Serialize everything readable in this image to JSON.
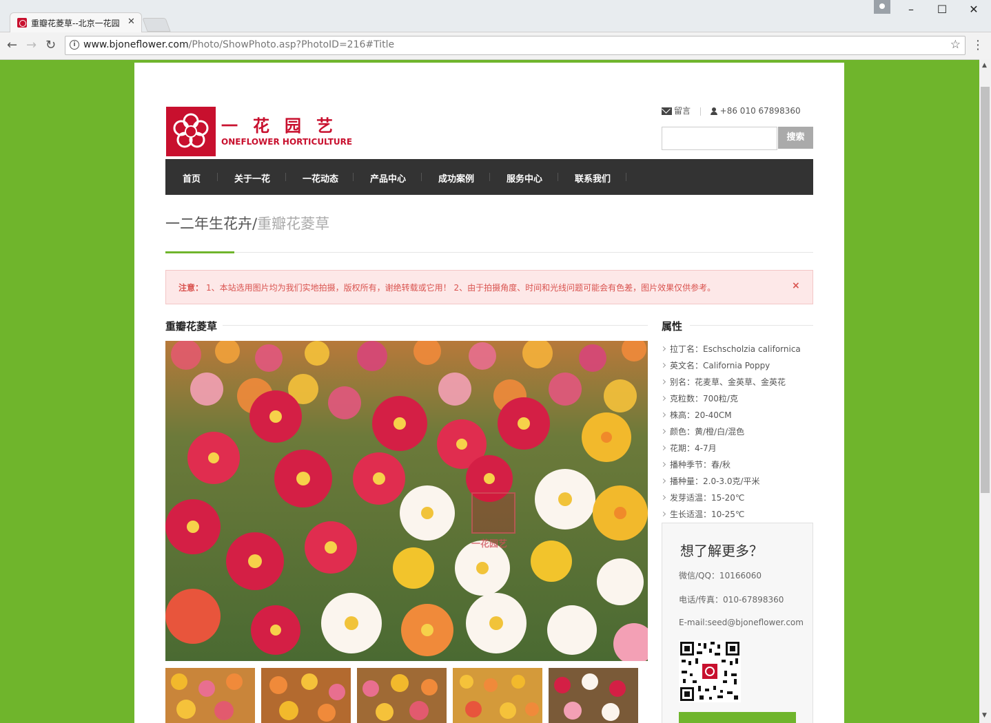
{
  "browser": {
    "tab_title": "重瓣花菱草--北京一花园",
    "url_host": "www.bjoneflower.com",
    "url_path": "/Photo/ShowPhoto.asp?PhotoID=216#Title"
  },
  "header": {
    "logo_cn": "一花园艺",
    "logo_en": "ONEFLOWER HORTICULTURE",
    "message_link": "留言",
    "phone": "+86 010 67898360",
    "search_button": "搜索",
    "search_placeholder": ""
  },
  "nav": {
    "items": [
      "首页",
      "关于一花",
      "一花动态",
      "产品中心",
      "成功案例",
      "服务中心",
      "联系我们"
    ]
  },
  "breadcrumb": {
    "parent": "一二年生花卉",
    "separator": "/",
    "current": "重瓣花菱草"
  },
  "notice": {
    "label": "注意：",
    "text": "1、本站选用图片均为我们实地拍摄，版权所有，谢绝转载或它用！ 2、由于拍摄角度、时间和光线问题可能会有色差，图片效果仅供参考。",
    "close": "×"
  },
  "product": {
    "title": "重瓣花菱草",
    "watermark": "一花园艺"
  },
  "attributes": {
    "title": "属性",
    "items": [
      "拉丁名：Eschscholzia californica",
      "英文名：California Poppy",
      "别名：花麦草、金英草、金英花",
      "克粒数：700粒/克",
      "株高：20-40CM",
      "颜色：黄/橙/白/混色",
      "花期：4-7月",
      "播种季节：春/秋",
      "播种量：2.0-3.0克/平米",
      "发芽适温：15-20℃",
      "生长适温：10-25℃"
    ]
  },
  "contact": {
    "title": "想了解更多？",
    "wechat": "微信/QQ：10166060",
    "phone": "电话/传真：010-67898360",
    "email": "E-mail:seed@bjoneflower.com"
  },
  "colors": {
    "brand_red": "#c8102e",
    "accent_green": "#6fb52c",
    "nav_dark": "#333333",
    "notice_red": "#d9534f"
  }
}
